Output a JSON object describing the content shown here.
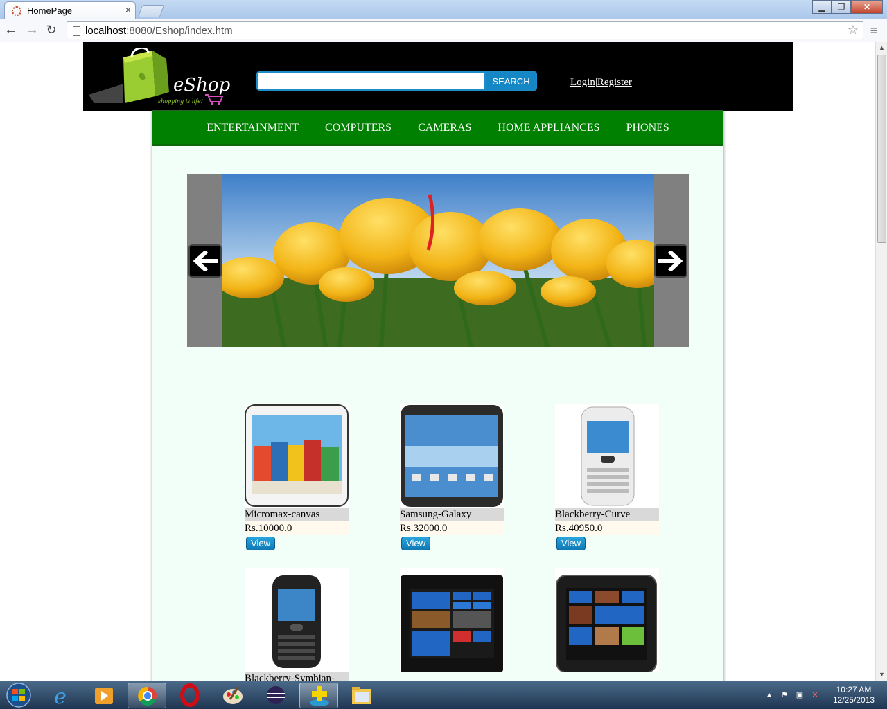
{
  "browser": {
    "tab_title": "HomePage",
    "tab_close": "×",
    "url_host": "localhost",
    "url_path": ":8080/Eshop/index.htm"
  },
  "header": {
    "logo_text": "eShop",
    "logo_tagline": "shopping is life!",
    "search_placeholder": "",
    "search_button": "SEARCH",
    "login": "Login",
    "separator": "|",
    "register": "Register"
  },
  "categories": [
    "ENTERTAINMENT",
    "COMPUTERS",
    "CAMERAS",
    "HOME APPLIANCES",
    "PHONES"
  ],
  "products": [
    {
      "name": "Micromax-canvas",
      "price": "Rs.10000.0",
      "view": "View"
    },
    {
      "name": "Samsung-Galaxy",
      "price": "Rs.32000.0",
      "view": "View"
    },
    {
      "name": "Blackberry-Curve",
      "price": "Rs.40950.0",
      "view": "View"
    },
    {
      "name": "Blackberry-Symbian-",
      "price": "",
      "view": ""
    },
    {
      "name": "",
      "price": "",
      "view": ""
    },
    {
      "name": "",
      "price": "",
      "view": ""
    }
  ],
  "taskbar": {
    "time": "10:27 AM",
    "date": "12/25/2013"
  },
  "colors": {
    "nav_green": "#008000",
    "search_blue": "#1587c4",
    "content_bg": "#f2fff8"
  }
}
